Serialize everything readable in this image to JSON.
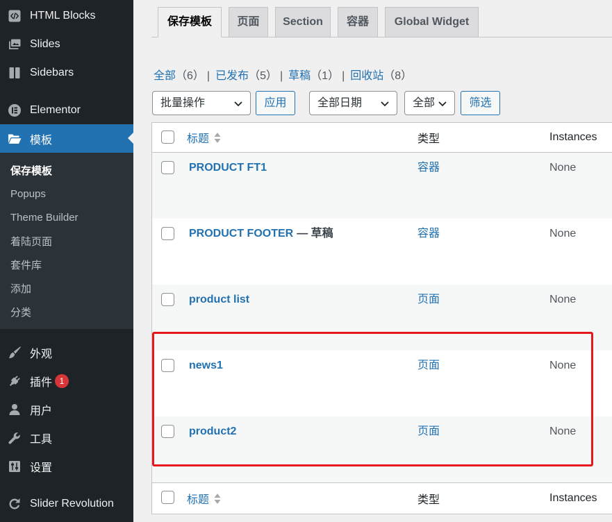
{
  "sidebar": {
    "group1": [
      {
        "label": "HTML Blocks",
        "icon": "code-block-icon"
      },
      {
        "label": "Slides",
        "icon": "images-icon"
      },
      {
        "label": "Sidebars",
        "icon": "columns-icon"
      }
    ],
    "group2": [
      {
        "label": "Elementor",
        "icon": "elementor-icon"
      },
      {
        "label": "模板",
        "icon": "folder-open-icon",
        "active": true
      }
    ],
    "submenu": [
      {
        "label": "保存模板",
        "current": true
      },
      {
        "label": "Popups"
      },
      {
        "label": "Theme Builder"
      },
      {
        "label": "着陆页面"
      },
      {
        "label": "套件库"
      },
      {
        "label": "添加"
      },
      {
        "label": "分类"
      }
    ],
    "group3": [
      {
        "label": "外观",
        "icon": "paintbrush-icon"
      },
      {
        "label": "插件",
        "icon": "plug-icon",
        "badge": "1"
      },
      {
        "label": "用户",
        "icon": "user-icon"
      },
      {
        "label": "工具",
        "icon": "wrench-icon"
      },
      {
        "label": "设置",
        "icon": "settings-icon"
      }
    ],
    "group4": [
      {
        "label": "Slider Revolution",
        "icon": "slider-revolution-icon"
      }
    ]
  },
  "tabs": [
    {
      "label": "保存模板",
      "active": true
    },
    {
      "label": "页面"
    },
    {
      "label": "Section"
    },
    {
      "label": "容器"
    },
    {
      "label": "Global Widget"
    }
  ],
  "views": [
    {
      "label": "全部",
      "count": "（6）"
    },
    {
      "label": "已发布",
      "count": "（5）"
    },
    {
      "label": "草稿",
      "count": "（1）"
    },
    {
      "label": "回收站",
      "count": "（8）"
    }
  ],
  "views_separator": "|",
  "filters": {
    "bulk_action": "批量操作",
    "apply_label": "应用",
    "date": "全部日期",
    "type": "全部",
    "filter_label": "筛选"
  },
  "table": {
    "columns": {
      "title": "标题",
      "type": "类型",
      "instances": "Instances"
    },
    "rows": [
      {
        "title": "PRODUCT FT1",
        "type": "容器",
        "instances": "None"
      },
      {
        "title": "PRODUCT FOOTER",
        "state": "— 草稿",
        "type": "容器",
        "instances": "None"
      },
      {
        "title": "product list",
        "type": "页面",
        "instances": "None"
      },
      {
        "title": "news1",
        "type": "页面",
        "instances": "None"
      },
      {
        "title": "product2",
        "type": "页面",
        "instances": "None"
      }
    ]
  },
  "colors": {
    "sidebar_bg": "#1d2327",
    "accent": "#2271b1",
    "badge": "#d63638",
    "highlight_box": "#e5181e"
  }
}
